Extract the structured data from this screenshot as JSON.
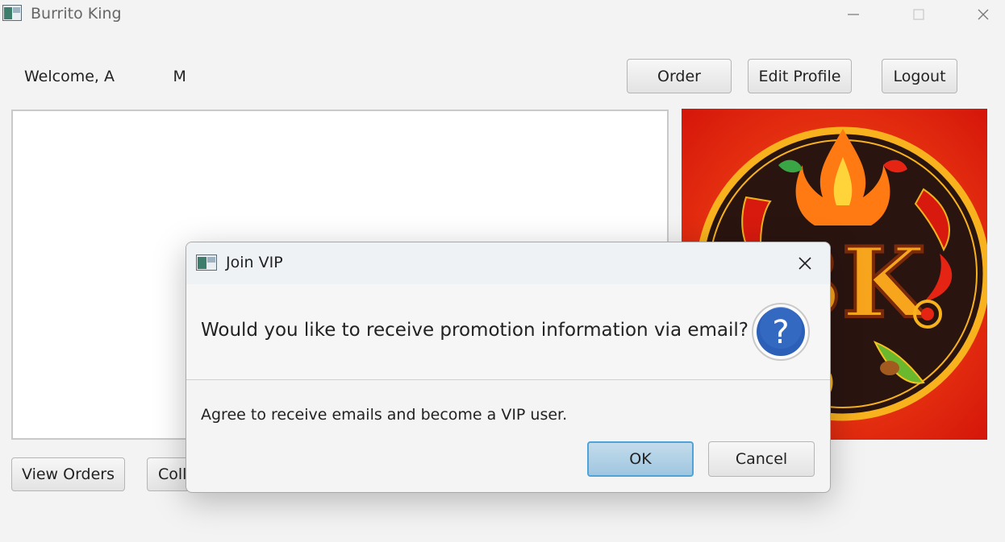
{
  "window": {
    "title": "Burrito King",
    "icon": "app-window-icon",
    "controls": [
      "minimize-icon",
      "maximize-icon",
      "close-icon"
    ]
  },
  "header": {
    "welcome_text": "Welcome, A            M",
    "order_label": "Order",
    "edit_profile_label": "Edit Profile",
    "logout_label": "Logout"
  },
  "main": {
    "list_items": [],
    "logo_letters": "BK"
  },
  "footer": {
    "view_orders_label": "View Orders",
    "collect_label_partial": "Coll"
  },
  "dialog": {
    "title": "Join VIP",
    "header_text": "Would you like to receive promotion information via email?",
    "content_text": "Agree to receive emails and become a VIP user.",
    "ok_label": "OK",
    "cancel_label": "Cancel",
    "icon": "question-icon"
  },
  "colors": {
    "logo_background": "#e62a10",
    "ok_button": "#a9cde6",
    "question_icon": "#2c5fb8"
  }
}
